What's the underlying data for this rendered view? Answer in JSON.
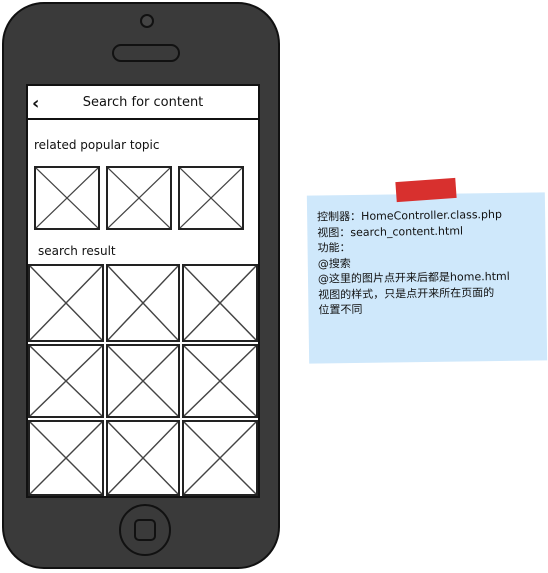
{
  "app": {
    "nav_title": "Search for content",
    "back_glyph": "‹"
  },
  "sections": {
    "related_title": "related popular topic",
    "result_title": "search result"
  },
  "note": {
    "lines": [
      "控制器：HomeController.class.php",
      "视图：search_content.html",
      "功能：",
      "@搜索",
      "@这里的图片点开来后都是home.html",
      "视图的样式，只是点开来所在页面的",
      "位置不同"
    ]
  },
  "colors": {
    "phone": "#3a3a3a",
    "note": "#cfe8fb",
    "tape": "#d8302e"
  }
}
